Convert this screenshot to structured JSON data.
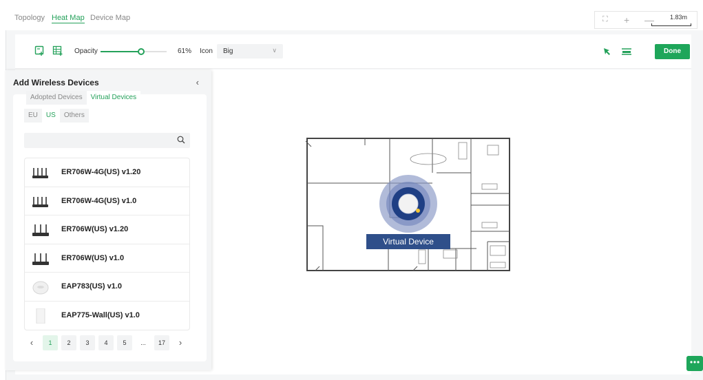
{
  "tabs": [
    {
      "label": "Topology",
      "active": false
    },
    {
      "label": "Heat Map",
      "active": true
    },
    {
      "label": "Device Map",
      "active": false
    }
  ],
  "zoom": {
    "scale_label": "1.83m"
  },
  "toolbar": {
    "opacity_label": "Opacity",
    "opacity_value": "61%",
    "opacity_fraction": 0.61,
    "icon_label": "Icon",
    "icon_select_value": "Big",
    "done_label": "Done"
  },
  "panel": {
    "title": "Add Wireless Devices",
    "device_tabs": [
      {
        "label": "Adopted Devices",
        "active": false
      },
      {
        "label": "Virtual Devices",
        "active": true
      }
    ],
    "regions": [
      {
        "label": "EU",
        "active": false
      },
      {
        "label": "US",
        "active": true
      },
      {
        "label": "Others",
        "active": false
      }
    ],
    "search_placeholder": "",
    "devices": [
      {
        "name": "ER706W-4G(US) v1.20",
        "icon": "router-4-antenna-icon"
      },
      {
        "name": "ER706W-4G(US) v1.0",
        "icon": "router-4-antenna-icon"
      },
      {
        "name": "ER706W(US) v1.20",
        "icon": "router-3-antenna-icon"
      },
      {
        "name": "ER706W(US) v1.0",
        "icon": "router-3-antenna-icon"
      },
      {
        "name": "EAP783(US) v1.0",
        "icon": "ceiling-ap-icon"
      },
      {
        "name": "EAP775-Wall(US) v1.0",
        "icon": "wall-ap-icon"
      }
    ],
    "pager": {
      "pages": [
        "1",
        "2",
        "3",
        "4",
        "5",
        "...",
        "17"
      ],
      "current": "1"
    }
  },
  "map": {
    "device_label": "Virtual Device"
  },
  "colors": {
    "accent": "#24a15a",
    "done_button": "#1ea65a",
    "label_bg": "#2f4f8a",
    "heat_ring": "#7e8fbf",
    "heat_core": "#1f3f84"
  }
}
